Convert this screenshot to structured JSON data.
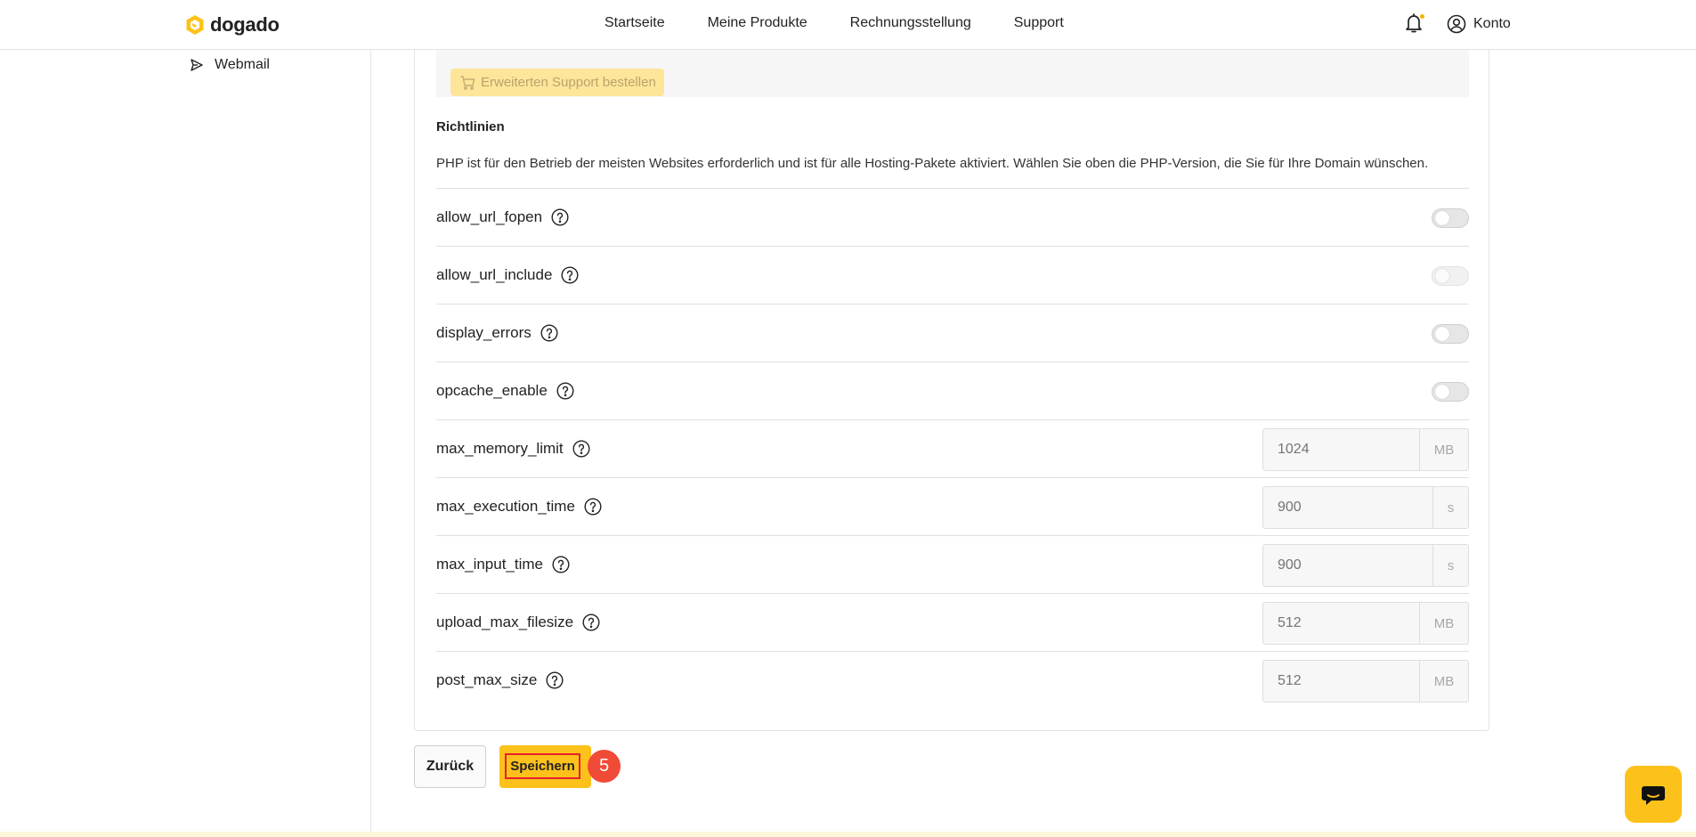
{
  "header": {
    "logo_text": "dogado",
    "nav": [
      "Startseite",
      "Meine Produkte",
      "Rechnungsstellung",
      "Support"
    ],
    "account_label": "Konto",
    "brand_color": "#fcc21b"
  },
  "sidebar": {
    "items": [
      {
        "label": "Webmail",
        "icon": "send-icon"
      }
    ]
  },
  "support": {
    "button_label": "Erweiterten Support bestellen"
  },
  "policies": {
    "title": "Richtlinien",
    "description": "PHP ist für den Betrieb der meisten Websites erforderlich und ist für alle Hosting-Pakete aktiviert. Wählen Sie oben die PHP-Version, die Sie für Ihre Domain wünschen.",
    "toggles": [
      {
        "name": "allow_url_fopen",
        "on": false,
        "disabled": false
      },
      {
        "name": "allow_url_include",
        "on": false,
        "disabled": true
      },
      {
        "name": "display_errors",
        "on": false,
        "disabled": false
      },
      {
        "name": "opcache_enable",
        "on": false,
        "disabled": false
      }
    ],
    "fields": [
      {
        "name": "max_memory_limit",
        "placeholder": "1024",
        "unit": "MB"
      },
      {
        "name": "max_execution_time",
        "placeholder": "900",
        "unit": "s"
      },
      {
        "name": "max_input_time",
        "placeholder": "900",
        "unit": "s"
      },
      {
        "name": "upload_max_filesize",
        "placeholder": "512",
        "unit": "MB"
      },
      {
        "name": "post_max_size",
        "placeholder": "512",
        "unit": "MB"
      }
    ]
  },
  "actions": {
    "back_label": "Zurück",
    "save_label": "Speichern",
    "step_badge": "5"
  }
}
